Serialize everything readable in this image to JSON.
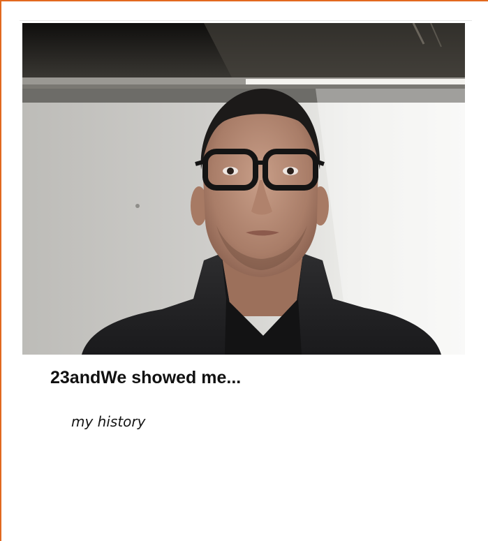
{
  "post": {
    "photo_icon": "portrait-photo",
    "headline": "23andWe showed me...",
    "subline": "my history"
  },
  "colors": {
    "frame_accent": "#e2691f",
    "background": "#ffffff",
    "headline_text": "#111111"
  }
}
